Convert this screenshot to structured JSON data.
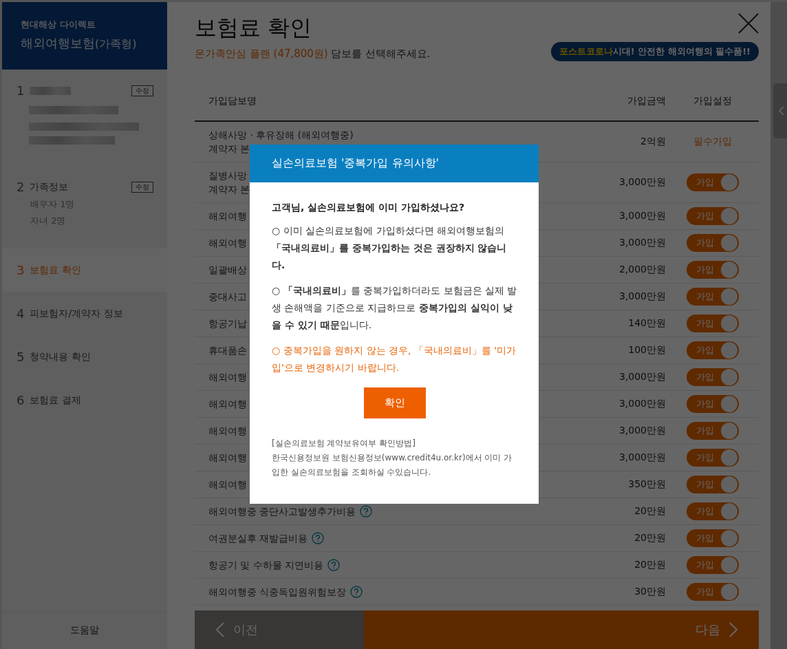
{
  "sidebar": {
    "brand": "현대해상 다이렉트",
    "product": "해외여행보험",
    "product_type": "(가족형)",
    "steps": [
      {
        "number": "1",
        "kind": "blurred",
        "edit": "수정",
        "selected": false
      },
      {
        "number": "2",
        "kind": "detail",
        "label": "가족정보",
        "edit": "수정",
        "details": [
          "배우자 1명",
          "자녀 2명"
        ],
        "selected": false
      },
      {
        "number": "3",
        "kind": "plain",
        "label": "보험료 확인",
        "selected": true
      },
      {
        "number": "4",
        "kind": "plain",
        "label": "피보험자/계약자 정보",
        "selected": false
      },
      {
        "number": "5",
        "kind": "plain",
        "label": "청약내용 확인",
        "selected": false
      },
      {
        "number": "6",
        "kind": "plain",
        "label": "보험료 결제",
        "selected": false
      }
    ],
    "help": "도움말"
  },
  "main": {
    "title": "보험료 확인",
    "plan": "온가족안심 플랜 (47,800원)",
    "instruction": "담보를 선택해주세요.",
    "banner": "**포스트코로나**시대! 안전한 해외여행의 필수품!!",
    "table": {
      "columns": [
        "가입담보명",
        "가입금액",
        "가입설정"
      ],
      "rows": [
        {
          "lines": [
            "상해사망 · 후유장해 (해외여행중)",
            "계약자 본"
          ],
          "amount": "2억원",
          "kind": "required",
          "setting": "필수가입"
        },
        {
          "lines": [
            "질병사망",
            "계약자 본"
          ],
          "amount": "3,000만원",
          "kind": "toggle",
          "setting": "가입",
          "on": true
        },
        {
          "lines": [
            "해외여행"
          ],
          "amount": "3,000만원",
          "kind": "toggle",
          "setting": "가입",
          "on": true
        },
        {
          "lines": [
            "해외여행"
          ],
          "amount": "3,000만원",
          "kind": "toggle",
          "setting": "가입",
          "on": true
        },
        {
          "lines": [
            "일괄배상"
          ],
          "amount": "2,000만원",
          "kind": "toggle",
          "setting": "가입",
          "on": true
        },
        {
          "lines": [
            "중대사고"
          ],
          "amount": "3,000만원",
          "kind": "toggle",
          "setting": "가입",
          "on": true
        },
        {
          "lines": [
            "항공기납"
          ],
          "amount": "140만원",
          "kind": "toggle",
          "setting": "가입",
          "on": true
        },
        {
          "lines": [
            "휴대품손"
          ],
          "amount": "100만원",
          "kind": "toggle",
          "setting": "가입",
          "on": true
        },
        {
          "lines": [
            "해외여행"
          ],
          "amount": "3,000만원",
          "kind": "toggle",
          "setting": "가입",
          "on": true
        },
        {
          "lines": [
            "해외여행"
          ],
          "amount": "3,000만원",
          "kind": "toggle",
          "setting": "가입",
          "on": true
        },
        {
          "lines": [
            "해외여행"
          ],
          "amount": "3,000만원",
          "kind": "toggle",
          "setting": "가입",
          "on": true
        },
        {
          "lines": [
            "해외여행"
          ],
          "amount": "3,000만원",
          "kind": "toggle",
          "setting": "가입",
          "on": true
        },
        {
          "lines": [
            "해외여행"
          ],
          "amount": "350만원",
          "kind": "toggle",
          "setting": "가입",
          "on": true
        },
        {
          "lines": [
            "해외여행중 중단사고발생추가비용"
          ],
          "help": true,
          "amount": "20만원",
          "kind": "toggle",
          "setting": "가입",
          "on": true
        },
        {
          "lines": [
            "여권분실후 재발급비용"
          ],
          "help": true,
          "amount": "20만원",
          "kind": "toggle",
          "setting": "가입",
          "on": true
        },
        {
          "lines": [
            "항공기 및 수하물 지연비용"
          ],
          "help": true,
          "amount": "20만원",
          "kind": "toggle",
          "setting": "가입",
          "on": true
        },
        {
          "lines": [
            "해외여행중 식중독입원위험보장"
          ],
          "help": true,
          "amount": "30만원",
          "kind": "toggle",
          "setting": "가입",
          "on": true
        }
      ]
    },
    "prev": "이전",
    "next": "다음"
  },
  "dialog": {
    "title": "실손의료보험 '중복가입 유의사항'",
    "question": "고객님, 실손의료보험에 이미 가입하셨나요?",
    "paragraphs": [
      {
        "kind": "normal",
        "text": "○ 이미 실손의료보험에 가입하셨다면 해외여행보험의 **「국내의료비」를 중복가입하는 것은 권장하지 않습니다.**"
      },
      {
        "kind": "normal",
        "text": "○ **「국내의료비」**를 중복가입하더라도 보험금은 실제 발생 손해액을 기준으로 지급하므로 **중복가입의 실익이 낮을 수 있기 때문**입니다."
      },
      {
        "kind": "warning",
        "text": "○ 중복가입을 원하지 않는 경우, 「국내의료비」를 '미가입'으로 변경하시기 바랍니다."
      }
    ],
    "confirm": "확인",
    "note_title": "[실손의료보험 계약보유여부 확인방법]",
    "note": "한국신용정보원 보험신용정보(www.credit4u.or.kr)에서 이미 가입한 실손의료보험을 조회하실 수있습니다."
  }
}
